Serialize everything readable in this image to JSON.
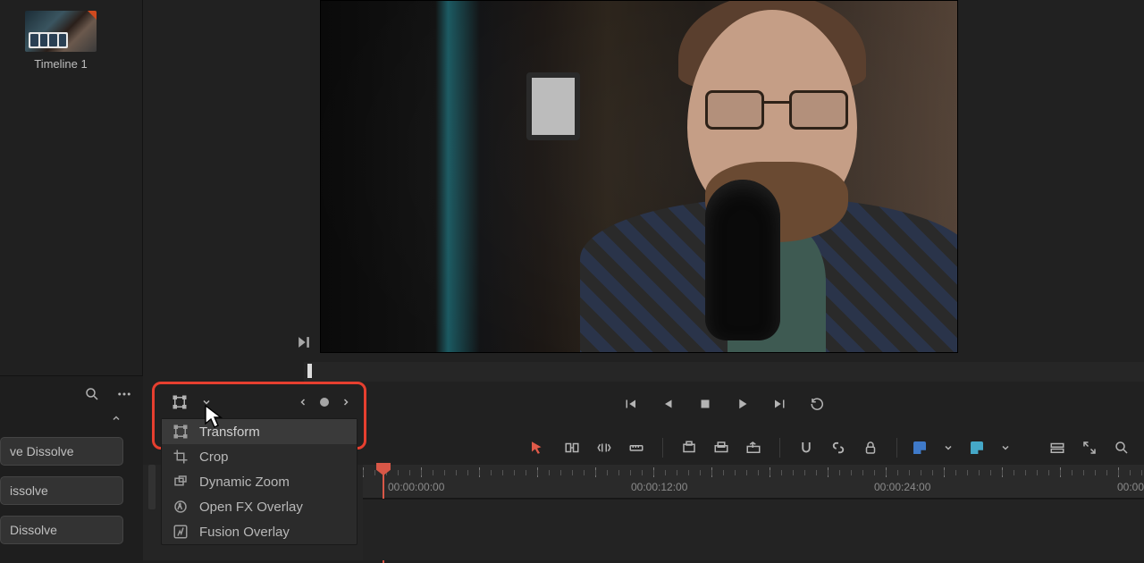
{
  "media_pool": {
    "clip_label": "Timeline 1"
  },
  "viewer_controls": {
    "dropdown": {
      "items": [
        {
          "icon": "transform-icon",
          "label": "Transform",
          "selected": true
        },
        {
          "icon": "crop-icon",
          "label": "Crop",
          "selected": false
        },
        {
          "icon": "dynamic-zoom-icon",
          "label": "Dynamic Zoom",
          "selected": false
        },
        {
          "icon": "openfx-icon",
          "label": "Open FX Overlay",
          "selected": false
        },
        {
          "icon": "fusion-icon",
          "label": "Fusion Overlay",
          "selected": false
        }
      ]
    }
  },
  "fx_panel": {
    "items": [
      "ve Dissolve",
      "issolve",
      "Dissolve"
    ]
  },
  "timeline": {
    "timecodes": [
      {
        "label": "00:00:00:00",
        "pos": 28
      },
      {
        "label": "00:00:12:00",
        "pos": 300
      },
      {
        "label": "00:00:24:00",
        "pos": 572
      },
      {
        "label": "00:00",
        "pos": 844
      }
    ]
  },
  "colors": {
    "highlight": "#e63f2f",
    "playhead": "#d85747"
  }
}
